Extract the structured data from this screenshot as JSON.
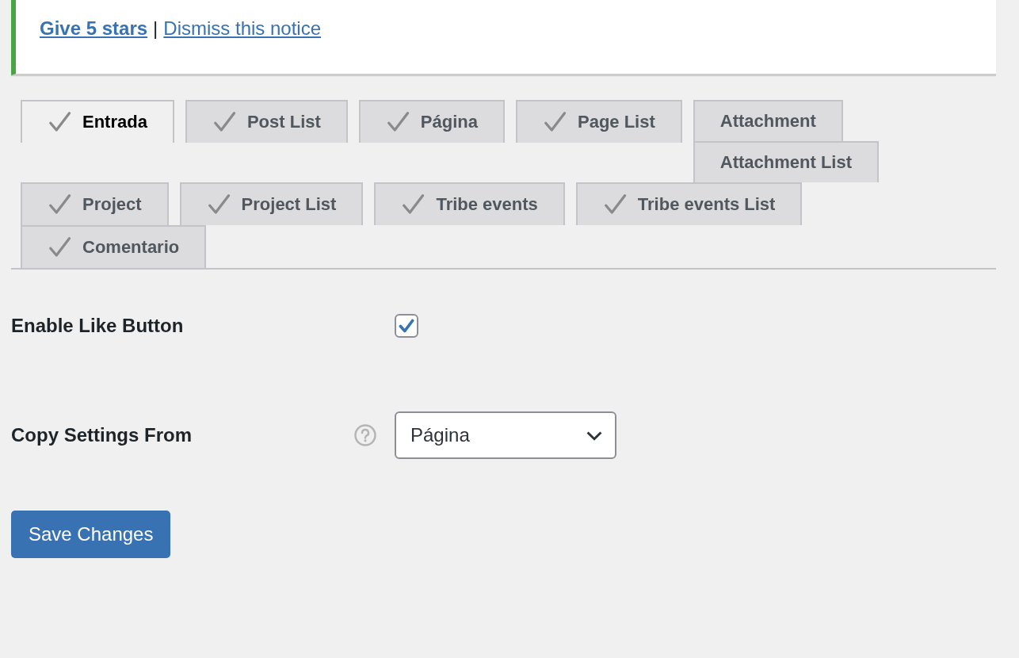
{
  "notice": {
    "links": [
      {
        "text": "Give 5 stars",
        "bold": true
      },
      {
        "text": "Dismiss this notice",
        "bold": false
      }
    ],
    "separator": "|"
  },
  "tabs": [
    {
      "label": "Entrada",
      "selected": true,
      "checked": true
    },
    {
      "label": "Post List",
      "selected": false,
      "checked": true
    },
    {
      "label": "Página",
      "selected": false,
      "checked": true
    },
    {
      "label": "Page List",
      "selected": false,
      "checked": true
    },
    {
      "label": "Attachment",
      "selected": false,
      "checked": false
    },
    {
      "label": "Attachment List",
      "selected": false,
      "checked": false
    },
    {
      "label": "Project",
      "selected": false,
      "checked": true
    },
    {
      "label": "Project List",
      "selected": false,
      "checked": true
    },
    {
      "label": "Tribe events",
      "selected": false,
      "checked": true
    },
    {
      "label": "Tribe events List",
      "selected": false,
      "checked": true
    },
    {
      "label": "Comentario",
      "selected": false,
      "checked": true
    }
  ],
  "settings": [
    {
      "kind": "checkbox",
      "label": "Enable Like Button",
      "checked": true
    },
    {
      "kind": "select",
      "label": "Copy Settings From",
      "value": "Página"
    }
  ],
  "save_button": "Save Changes"
}
